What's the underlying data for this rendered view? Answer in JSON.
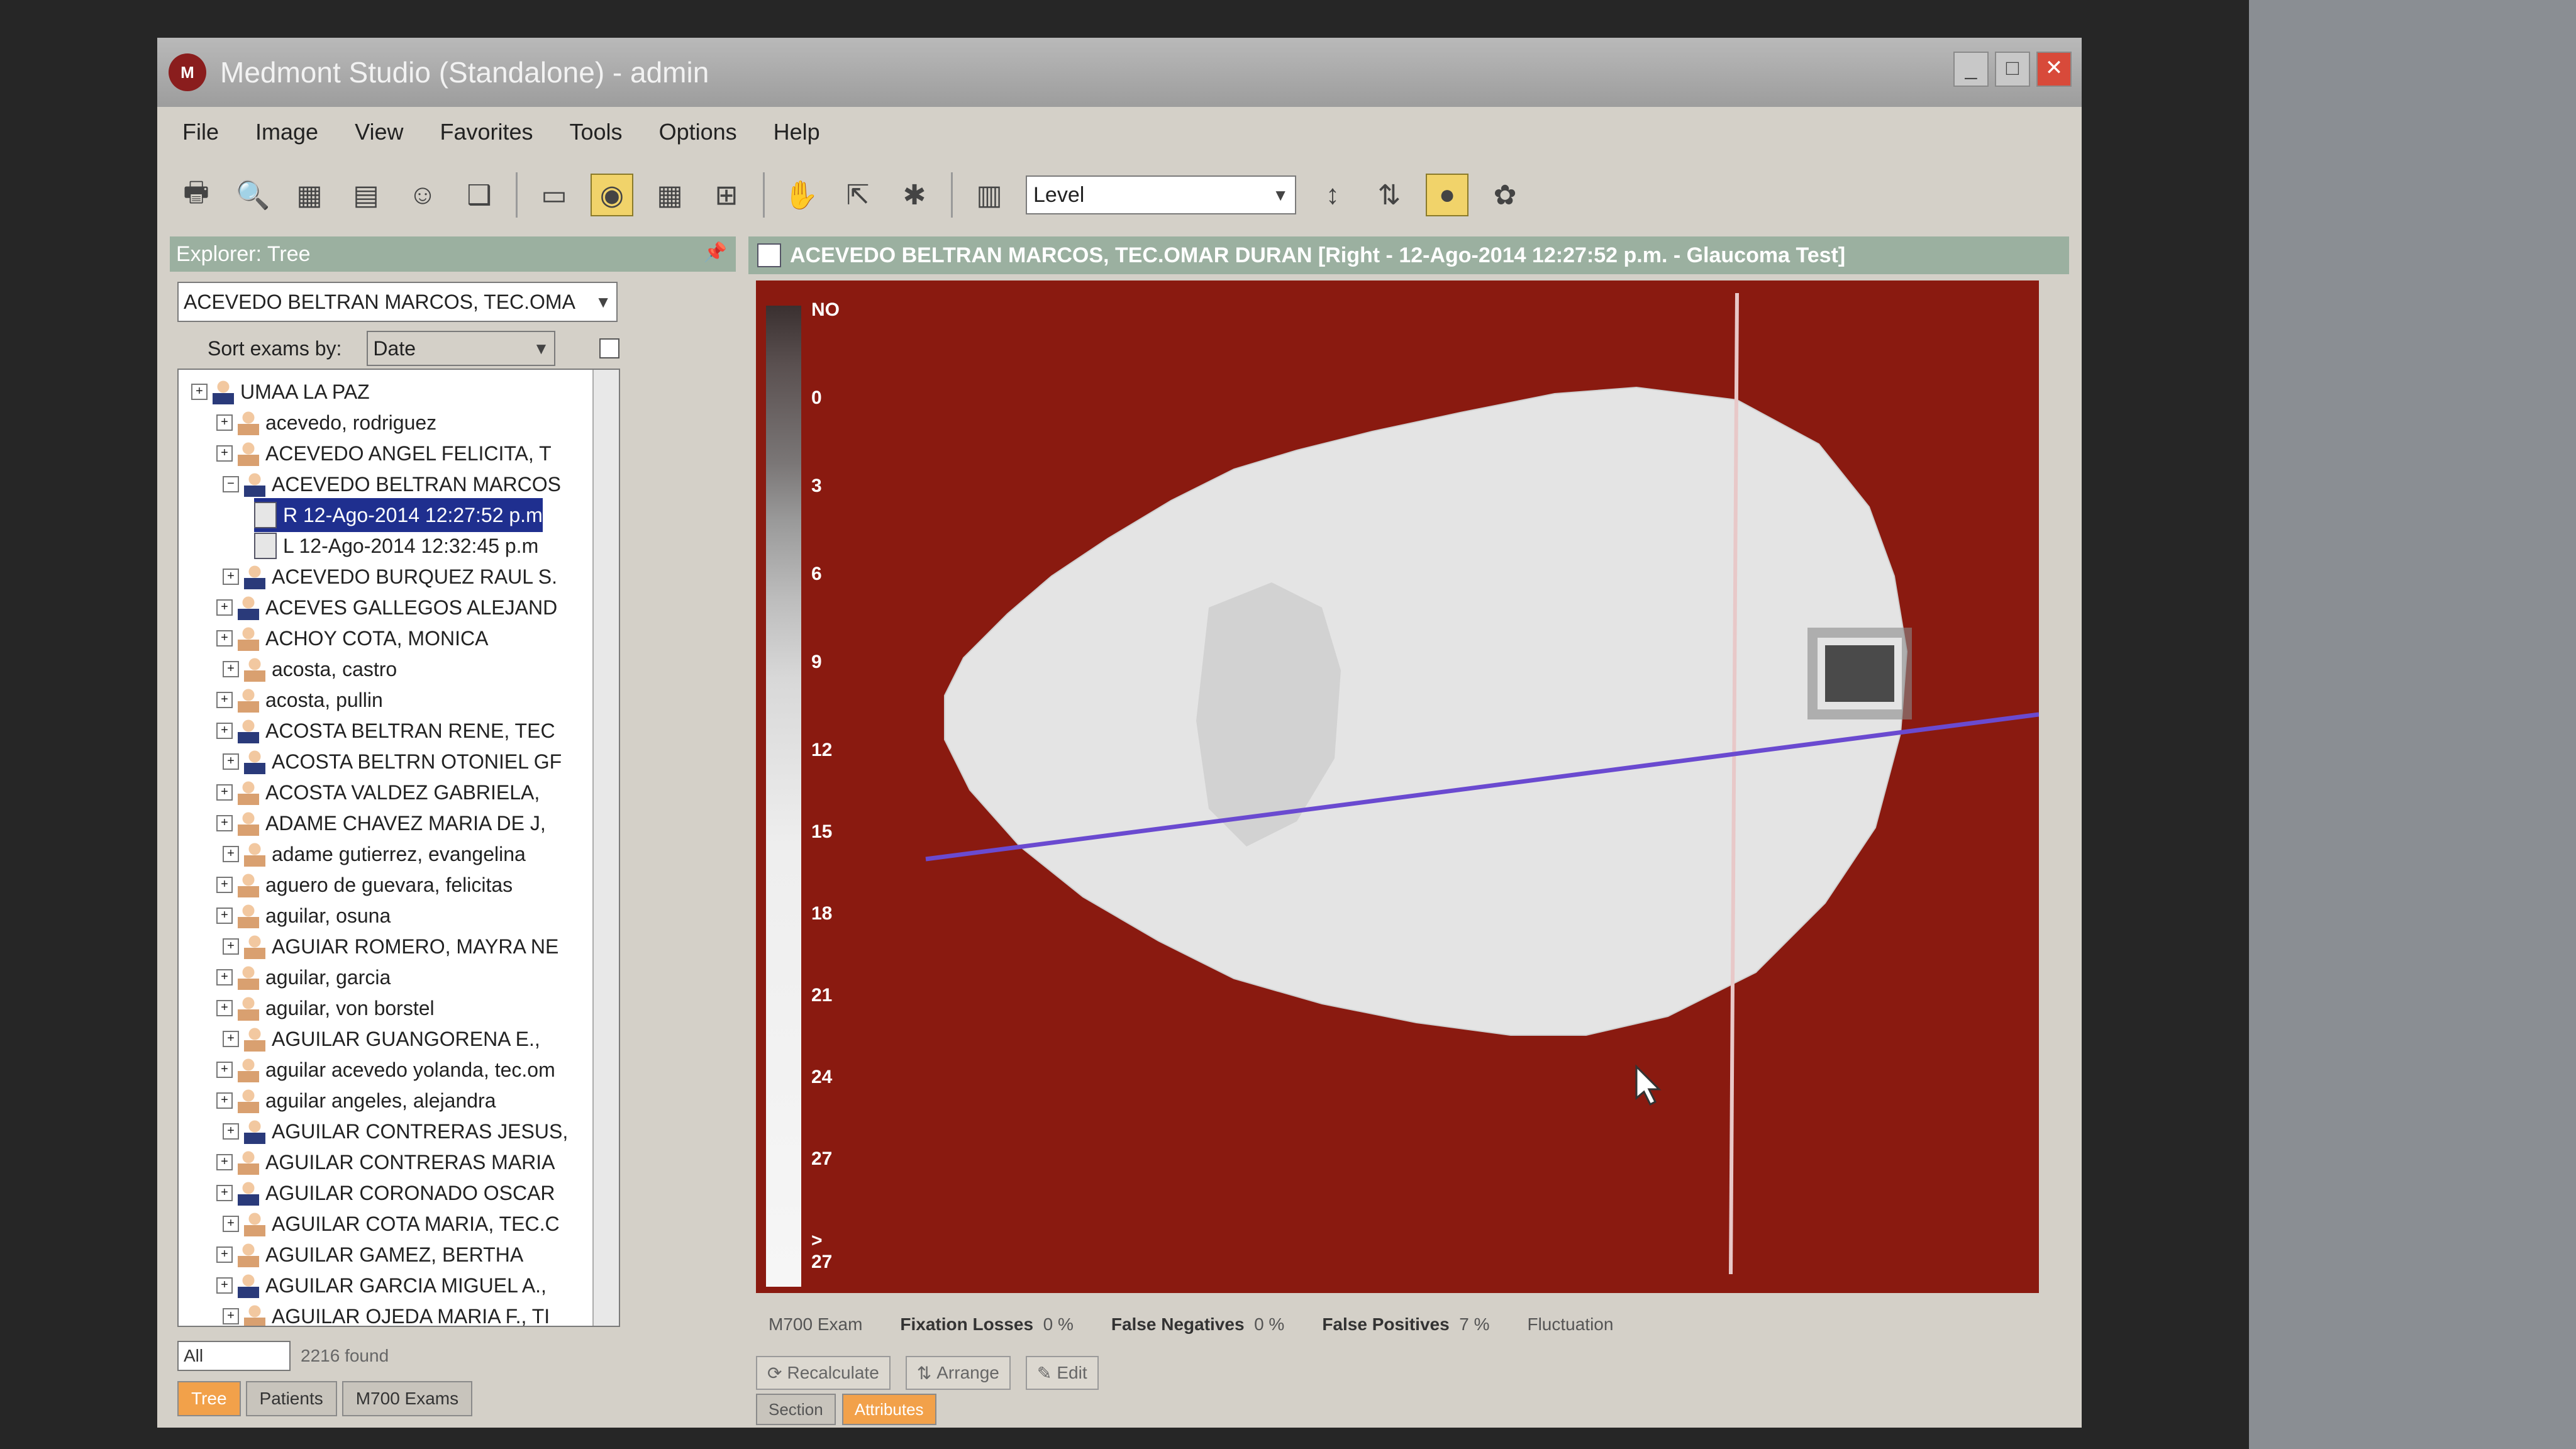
{
  "window": {
    "title": "Medmont Studio (Standalone) - admin",
    "app_icon_text": "M"
  },
  "menu": [
    "File",
    "Image",
    "View",
    "Favorites",
    "Tools",
    "Options",
    "Help"
  ],
  "toolbar": {
    "level_select": "Level"
  },
  "explorer": {
    "title": "Explorer: Tree",
    "patient_select": "ACEVEDO BELTRAN MARCOS, TEC.OMA",
    "sort_label": "Sort exams by:",
    "sort_value": "Date",
    "tree": [
      {
        "label": "UMAA LA PAZ",
        "kind": "root"
      },
      {
        "label": "acevedo, rodriguez",
        "kind": "female"
      },
      {
        "label": "ACEVEDO ANGEL FELICITA, T",
        "kind": "female"
      },
      {
        "label": "ACEVEDO BELTRAN MARCOS",
        "kind": "male"
      },
      {
        "label": "R 12-Ago-2014 12:27:52 p.m",
        "kind": "exam",
        "selected": true
      },
      {
        "label": "L 12-Ago-2014 12:32:45 p.m",
        "kind": "exam"
      },
      {
        "label": "ACEVEDO BURQUEZ RAUL S.",
        "kind": "male"
      },
      {
        "label": "ACEVES GALLEGOS ALEJAND",
        "kind": "male"
      },
      {
        "label": "ACHOY COTA, MONICA",
        "kind": "female"
      },
      {
        "label": "acosta, castro",
        "kind": "female"
      },
      {
        "label": "acosta, pullin",
        "kind": "female"
      },
      {
        "label": "ACOSTA BELTRAN RENE, TEC",
        "kind": "male"
      },
      {
        "label": "ACOSTA BELTRN OTONIEL GF",
        "kind": "male"
      },
      {
        "label": "ACOSTA VALDEZ GABRIELA,",
        "kind": "female"
      },
      {
        "label": "ADAME CHAVEZ MARIA DE J,",
        "kind": "female"
      },
      {
        "label": "adame gutierrez, evangelina",
        "kind": "female"
      },
      {
        "label": "aguero de guevara, felicitas",
        "kind": "female"
      },
      {
        "label": "aguilar, osuna",
        "kind": "female"
      },
      {
        "label": "AGUIAR ROMERO, MAYRA NE",
        "kind": "female"
      },
      {
        "label": "aguilar, garcia",
        "kind": "female"
      },
      {
        "label": "aguilar, von borstel",
        "kind": "female"
      },
      {
        "label": "AGUILAR GUANGORENA E.,",
        "kind": "female"
      },
      {
        "label": "aguilar acevedo yolanda, tec.om",
        "kind": "female"
      },
      {
        "label": "aguilar angeles, alejandra",
        "kind": "female"
      },
      {
        "label": "AGUILAR CONTRERAS JESUS,",
        "kind": "male"
      },
      {
        "label": "AGUILAR CONTRERAS MARIA",
        "kind": "female"
      },
      {
        "label": "AGUILAR CORONADO OSCAR",
        "kind": "male"
      },
      {
        "label": "AGUILAR COTA MARIA, TEC.C",
        "kind": "female"
      },
      {
        "label": "AGUILAR GAMEZ, BERTHA",
        "kind": "female"
      },
      {
        "label": "AGUILAR GARCIA MIGUEL A.,",
        "kind": "male"
      },
      {
        "label": "AGUILAR OJEDA MARIA F., TI",
        "kind": "female"
      }
    ],
    "filter_value": "All",
    "found_text": "2216 found",
    "tabs": [
      "Tree",
      "Patients",
      "M700 Exams"
    ]
  },
  "document": {
    "title": "ACEVEDO BELTRAN MARCOS, TEC.OMAR DURAN [Right - 12-Ago-2014 12:27:52 p.m. - Glaucoma Test]",
    "legend": [
      "NO",
      "0",
      "3",
      "6",
      "9",
      "12",
      "15",
      "18",
      "21",
      "24",
      "27",
      "> 27"
    ],
    "colors": {
      "background": "#8a1a10",
      "field": "#e3e3e3",
      "meridian": "#6a4ad0"
    },
    "stats": {
      "exam_label": "M700 Exam",
      "fixation_losses_label": "Fixation Losses",
      "fixation_losses_value": "0 %",
      "false_negatives_label": "False Negatives",
      "false_negatives_value": "0 %",
      "false_positives_label": "False Positives",
      "false_positives_value": "7 %",
      "fluctuation_label": "Fluctuation"
    },
    "actions": [
      "Recalculate",
      "Arrange",
      "Edit"
    ],
    "sub_tabs": [
      "Section",
      "Attributes"
    ]
  }
}
